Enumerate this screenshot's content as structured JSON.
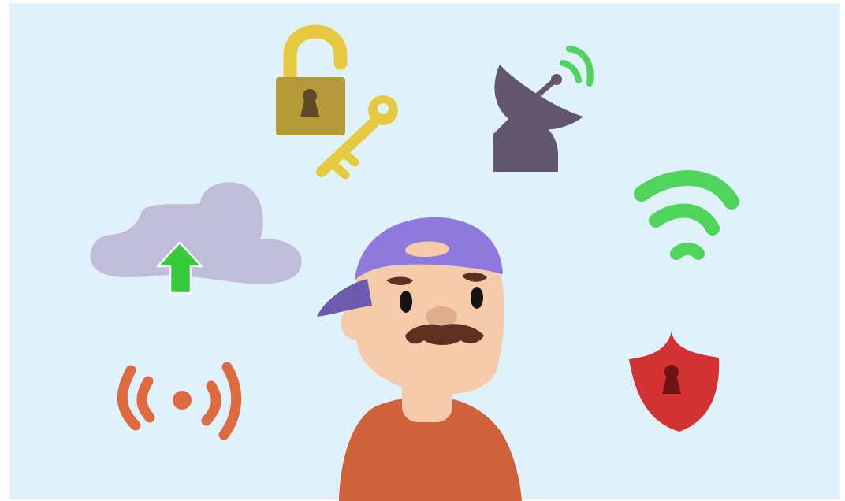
{
  "scene": {
    "background_color": "#dff1fb",
    "icons": [
      {
        "name": "padlock-open-icon",
        "color": "#b59a3a"
      },
      {
        "name": "key-icon",
        "color": "#e7c940"
      },
      {
        "name": "satellite-dish-icon",
        "color": "#63566f"
      },
      {
        "name": "signal-waves-icon",
        "color": "#4fd55c"
      },
      {
        "name": "wifi-icon",
        "color": "#4fd55c"
      },
      {
        "name": "cloud-upload-icon",
        "color": "#c0bdd8"
      },
      {
        "name": "upload-arrow-icon",
        "color": "#34cc3a"
      },
      {
        "name": "broadcast-icon",
        "color": "#e06a40"
      },
      {
        "name": "security-shield-icon",
        "color": "#d23232"
      }
    ],
    "character": {
      "name": "man-with-mustache",
      "cap_color": "#8e79dc",
      "skin_color": "#f6cbaa",
      "shirt_color": "#cf623b",
      "mustache_color": "#5c3122"
    }
  }
}
